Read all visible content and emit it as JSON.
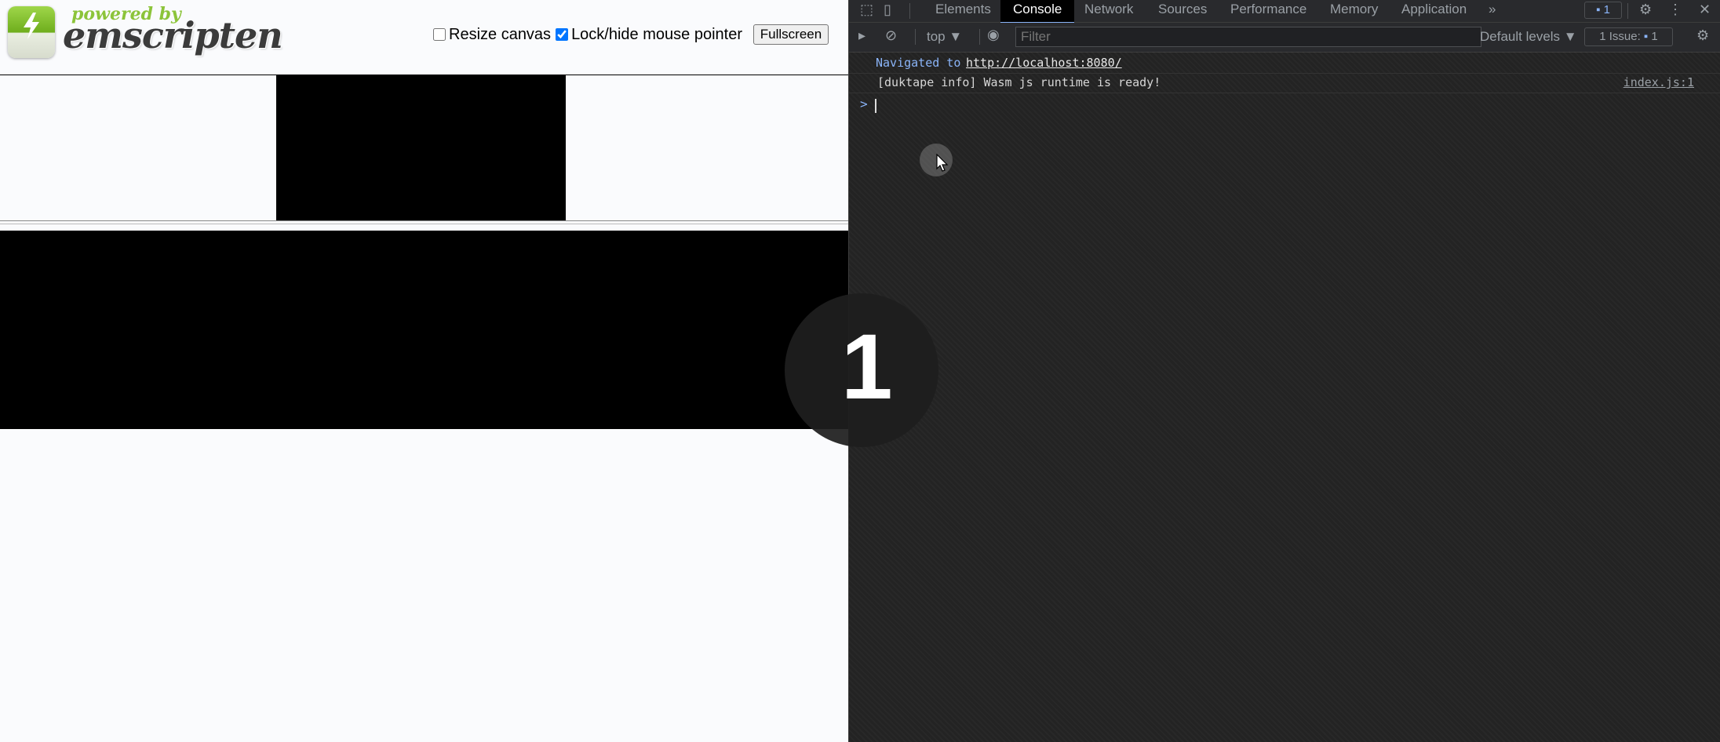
{
  "page": {
    "logo": {
      "powered_by": "powered by",
      "brand": "emscripten"
    },
    "controls": {
      "resize_canvas_label": "Resize canvas",
      "resize_canvas_checked": false,
      "lock_pointer_label": "Lock/hide mouse pointer",
      "lock_pointer_checked": true,
      "fullscreen_label": "Fullscreen"
    },
    "overlay_number": "1"
  },
  "devtools": {
    "tabs": [
      "Elements",
      "Console",
      "Network",
      "Sources",
      "Performance",
      "Memory",
      "Application"
    ],
    "active_tab": "Console",
    "more_tabs_icon": "»",
    "message_badge_count": "1",
    "toolbar": {
      "context": "top ▼",
      "filter_placeholder": "Filter",
      "levels": "Default levels ▼",
      "issues_label": "1 Issue:",
      "issues_count": "1"
    },
    "console": {
      "navigated_prefix": "Navigated to ",
      "navigated_url": "http://localhost:8080/",
      "log_message": "[duktape info] Wasm js runtime is ready!",
      "log_source": "index.js:1",
      "prompt_symbol": ">"
    }
  }
}
